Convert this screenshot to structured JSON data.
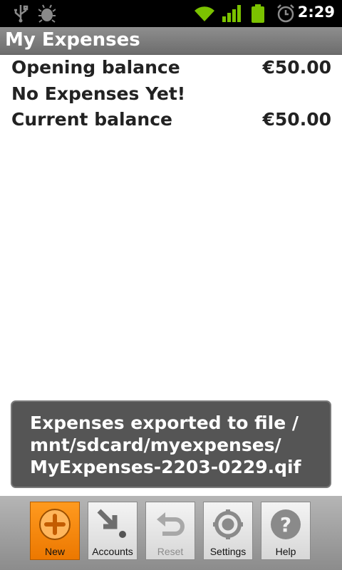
{
  "status_bar": {
    "time": "2:29",
    "icons": [
      "usb-icon",
      "debug-icon",
      "wifi-icon",
      "signal-icon",
      "battery-icon",
      "alarm-icon"
    ]
  },
  "app": {
    "title": "My Expenses"
  },
  "rows": {
    "opening_label": "Opening balance",
    "opening_value": "€50.00",
    "empty_label": "No Expenses Yet!",
    "current_label": "Current balance",
    "current_value": "€50.00"
  },
  "toast": {
    "text": "Expenses exported to file /\nmnt/sdcard/myexpenses/\nMyExpenses-2203-0229.qif"
  },
  "menu": {
    "new_label": "New",
    "accounts_label": "Accounts",
    "reset_label": "Reset",
    "settings_label": "Settings",
    "help_label": "Help"
  },
  "colors": {
    "accent": "#f07c00",
    "toast_bg": "#555555",
    "title_bar": "#7a7a7a"
  }
}
